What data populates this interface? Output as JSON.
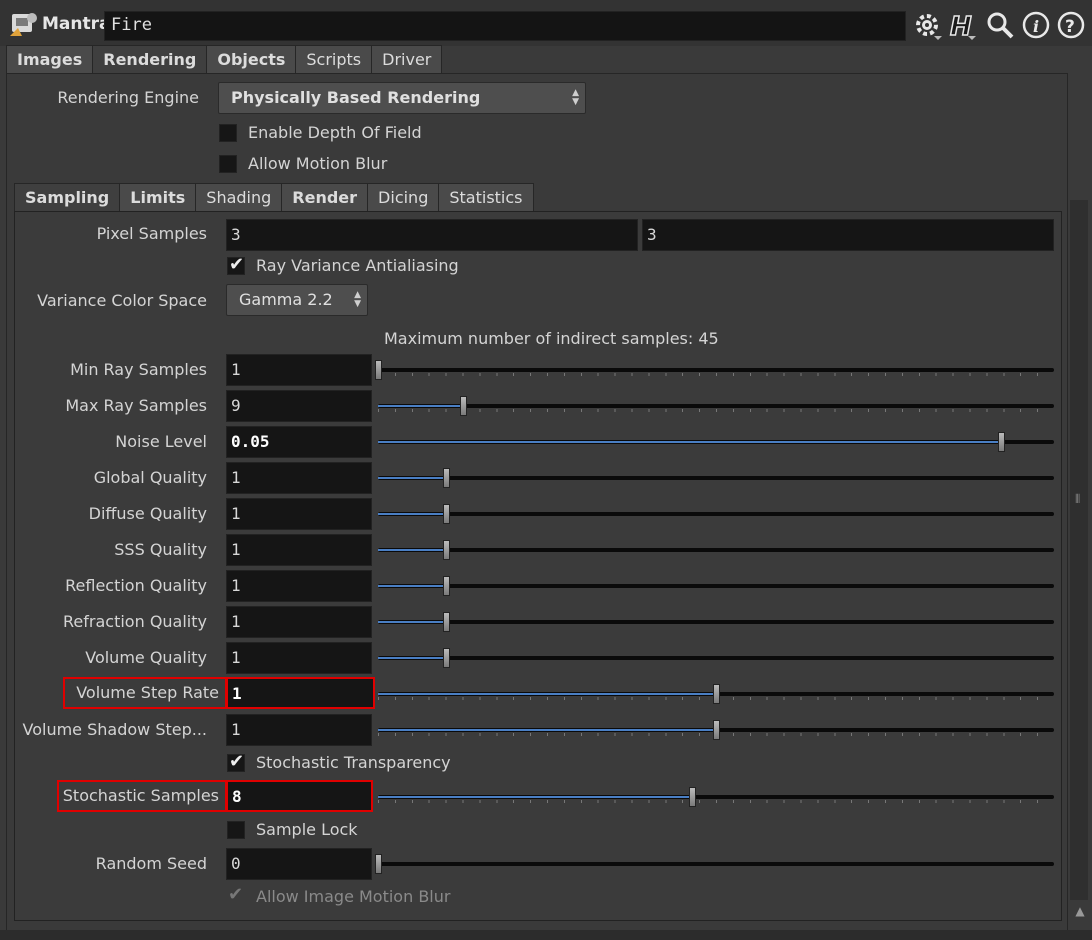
{
  "header": {
    "node_type": "Mantra",
    "node_name": "Fire",
    "icons": [
      "gear-icon",
      "houdini-help-icon",
      "search-icon",
      "info-icon",
      "question-icon"
    ]
  },
  "top_tabs": [
    {
      "label": "Images",
      "bold": true
    },
    {
      "label": "Rendering",
      "bold": true,
      "active": true
    },
    {
      "label": "Objects",
      "bold": true
    },
    {
      "label": "Scripts",
      "bold": false
    },
    {
      "label": "Driver",
      "bold": false
    }
  ],
  "rendering": {
    "engine_label": "Rendering Engine",
    "engine_value": "Physically Based Rendering",
    "depth_of_field": {
      "label": "Enable Depth Of Field",
      "checked": false
    },
    "motion_blur": {
      "label": "Allow Motion Blur",
      "checked": false
    }
  },
  "sub_tabs": [
    {
      "label": "Sampling",
      "bold": true,
      "active": true
    },
    {
      "label": "Limits",
      "bold": true
    },
    {
      "label": "Shading",
      "bold": false
    },
    {
      "label": "Render",
      "bold": true
    },
    {
      "label": "Dicing",
      "bold": false
    },
    {
      "label": "Statistics",
      "bold": false
    }
  ],
  "sampling": {
    "pixel_samples": {
      "label": "Pixel Samples",
      "x": "3",
      "y": "3"
    },
    "ray_variance": {
      "label": "Ray Variance Antialiasing",
      "checked": true
    },
    "variance_color_space": {
      "label": "Variance Color Space",
      "value": "Gamma 2.2"
    },
    "info_text": "Maximum number of indirect samples: 45",
    "params": {
      "min_ray_samples": {
        "label": "Min Ray Samples",
        "value": "1",
        "slider": 0.0
      },
      "max_ray_samples": {
        "label": "Max Ray Samples",
        "value": "9",
        "slider": 0.126
      },
      "noise_level": {
        "label": "Noise Level",
        "value": "0.05",
        "slider": 0.922
      },
      "global_quality": {
        "label": "Global Quality",
        "value": "1",
        "slider": 0.1
      },
      "diffuse_quality": {
        "label": "Diffuse Quality",
        "value": "1",
        "slider": 0.1
      },
      "sss_quality": {
        "label": "SSS Quality",
        "value": "1",
        "slider": 0.1
      },
      "reflection_quality": {
        "label": "Reflection Quality",
        "value": "1",
        "slider": 0.1
      },
      "refraction_quality": {
        "label": "Refraction Quality",
        "value": "1",
        "slider": 0.1
      },
      "volume_quality": {
        "label": "Volume Quality",
        "value": "1",
        "slider": 0.1
      },
      "volume_step_rate": {
        "label": "Volume Step Rate",
        "value": "1",
        "slider": 0.5
      },
      "volume_shadow_step": {
        "label": "Volume Shadow Step...",
        "value": "1",
        "slider": 0.5
      },
      "stochastic_samples": {
        "label": "Stochastic Samples",
        "value": "8",
        "slider": 0.465
      },
      "random_seed": {
        "label": "Random Seed",
        "value": "0",
        "slider": 0.0
      }
    },
    "stochastic_transparency": {
      "label": "Stochastic Transparency",
      "checked": true
    },
    "sample_lock": {
      "label": "Sample Lock",
      "checked": false
    },
    "image_motion_blur": {
      "label": "Allow Image Motion Blur",
      "checked": true,
      "disabled": true
    }
  }
}
